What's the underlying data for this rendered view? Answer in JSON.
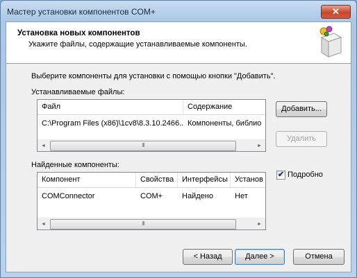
{
  "window": {
    "title": "Мастер установки компонентов COM+",
    "close_glyph": "✕"
  },
  "header": {
    "title": "Установка новых компонентов",
    "subtitle": "Укажите файлы, содержащие устанавливаемые компоненты."
  },
  "instructions": "Выберите компоненты для установки с помощью кнопки \"Добавить\".",
  "files_section": {
    "label": "Устанавливаемые файлы:",
    "columns": [
      "Файл",
      "Содержание"
    ],
    "rows": [
      [
        "C:\\Program Files (x86)\\1cv8\\8.3.10.2466...",
        "Компоненты, библио"
      ]
    ]
  },
  "components_section": {
    "label": "Найденные компоненты:",
    "columns": [
      "Компонент",
      "Свойства",
      "Интерфейсы",
      "Установ"
    ],
    "rows": [
      [
        "COMConnector",
        "COM+",
        "Найдено",
        "Нет"
      ]
    ]
  },
  "scrollbar": {
    "left_glyph": "◄",
    "right_glyph": "►",
    "grip_glyph": "III"
  },
  "buttons": {
    "add": "Добавить...",
    "remove": "Удалить",
    "back": "< Назад",
    "next": "Далее >",
    "cancel": "Отмена"
  },
  "details_checkbox": {
    "label": "Подробно",
    "checked": true,
    "glyph": "✔"
  },
  "icons": {
    "header_icon": "component-box-icon",
    "check": "checkmark-icon"
  },
  "colors": {
    "titlebar": "#b8d2ec",
    "close_button": "#c8462c",
    "dialog_bg": "#f0f0f0",
    "default_button_border": "#3c7fb1"
  }
}
